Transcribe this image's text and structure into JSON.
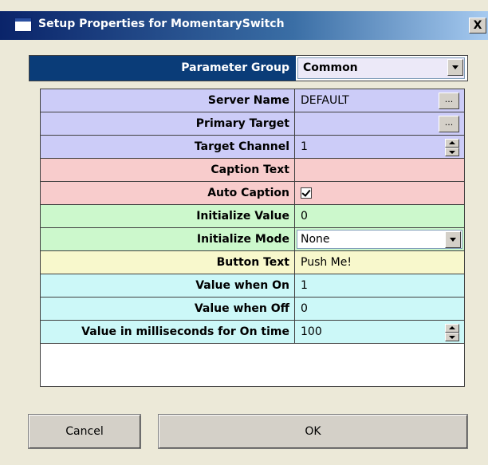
{
  "window": {
    "title": "Setup Properties for MomentarySwitch",
    "close_label": "X"
  },
  "parameter_group": {
    "label": "Parameter Group",
    "selected": "Common"
  },
  "rows": [
    {
      "label": "Server Name",
      "value": "DEFAULT",
      "control": "ellipsis",
      "ellipsis_label": "...",
      "color": "#ccccf8"
    },
    {
      "label": "Primary Target",
      "value": "",
      "control": "ellipsis",
      "ellipsis_label": "...",
      "color": "#ccccf8"
    },
    {
      "label": "Target Channel",
      "value": "1",
      "control": "spinner",
      "color": "#ccccf8"
    },
    {
      "label": "Caption Text",
      "value": "",
      "control": "text",
      "color": "#f8cccc"
    },
    {
      "label": "Auto Caption",
      "value": "",
      "control": "checkbox",
      "checked": true,
      "color": "#f8cccc"
    },
    {
      "label": "Initialize Value",
      "value": "0",
      "control": "text",
      "color": "#ccf8cc"
    },
    {
      "label": "Initialize Mode",
      "value": "None",
      "control": "dropdown",
      "color": "#ccf8cc"
    },
    {
      "label": "Button Text",
      "value": "Push Me!",
      "control": "text",
      "color": "#f8f8cc"
    },
    {
      "label": "Value when On",
      "value": "1",
      "control": "text",
      "color": "#ccf8f8"
    },
    {
      "label": "Value when Off",
      "value": "0",
      "control": "text",
      "color": "#ccf8f8"
    },
    {
      "label": "Value in milliseconds for On time",
      "value": "100",
      "control": "spinner",
      "color": "#ccf8f8"
    }
  ],
  "buttons": {
    "cancel": "Cancel",
    "ok": "OK"
  }
}
